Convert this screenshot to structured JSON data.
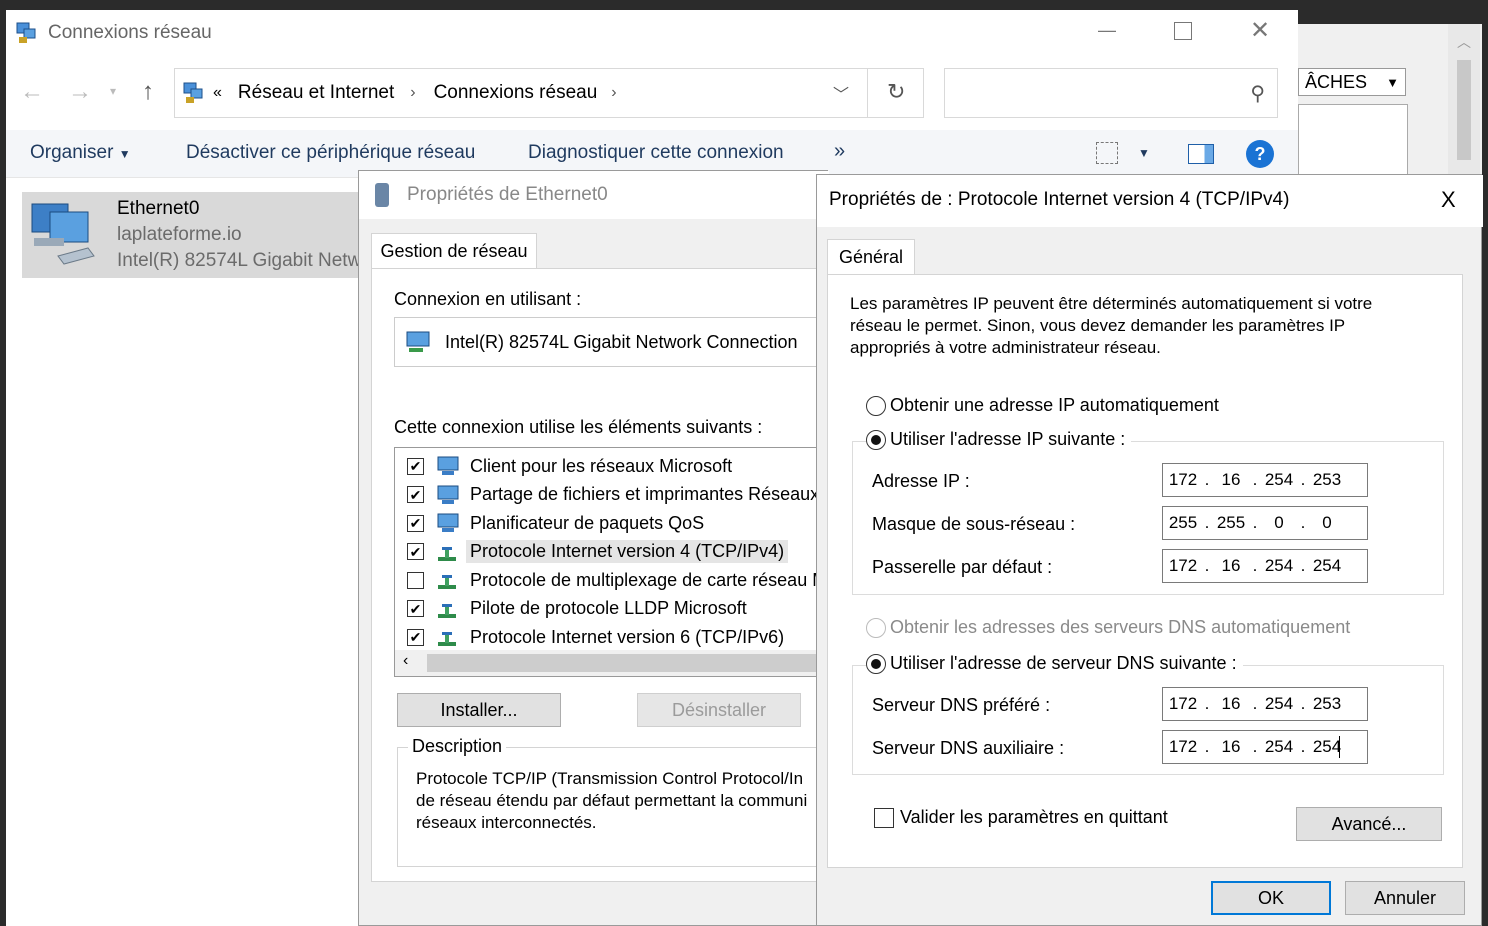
{
  "explorer": {
    "title": "Connexions réseau",
    "breadcrumb": [
      "Réseau et Internet",
      "Connexions réseau"
    ],
    "toolbar": {
      "organize": "Organiser",
      "disable": "Désactiver ce périphérique réseau",
      "diagnose": "Diagnostiquer cette connexion",
      "more": "»"
    },
    "connection": {
      "name": "Ethernet0",
      "domain": "laplateforme.io",
      "adapter": "Intel(R) 82574L Gigabit Netw"
    },
    "behind_window_dropdown": "ÂCHES"
  },
  "eth_props": {
    "title": "Propriétés de Ethernet0",
    "tab": "Gestion de réseau",
    "connect_using_label": "Connexion en utilisant :",
    "adapter": "Intel(R) 82574L Gigabit Network Connection",
    "items_label": "Cette connexion utilise les éléments suivants :",
    "items": [
      {
        "label": "Client pour les réseaux Microsoft",
        "checked": true,
        "icon": "network-client-icon"
      },
      {
        "label": "Partage de fichiers et imprimantes Réseaux M",
        "checked": true,
        "icon": "network-service-icon"
      },
      {
        "label": "Planificateur de paquets QoS",
        "checked": true,
        "icon": "network-service-icon"
      },
      {
        "label": "Protocole Internet version 4 (TCP/IPv4)",
        "checked": true,
        "icon": "protocol-icon"
      },
      {
        "label": "Protocole de multiplexage de carte réseau Mi",
        "checked": false,
        "icon": "protocol-icon"
      },
      {
        "label": "Pilote de protocole LLDP Microsoft",
        "checked": true,
        "icon": "protocol-icon"
      },
      {
        "label": "Protocole Internet version 6 (TCP/IPv6)",
        "checked": true,
        "icon": "protocol-icon"
      }
    ],
    "install_btn": "Installer...",
    "uninstall_btn": "Désinstaller",
    "description_label": "Description",
    "description_lines": [
      "Protocole TCP/IP (Transmission Control Protocol/In",
      "de réseau étendu par défaut permettant la communi",
      "réseaux interconnectés."
    ]
  },
  "ipv4": {
    "title": "Propriétés de : Protocole Internet version 4 (TCP/IPv4)",
    "close": "X",
    "tab": "Général",
    "intro_lines": [
      "Les paramètres IP peuvent être déterminés automatiquement si votre",
      "réseau le permet. Sinon, vous devez demander les paramètres IP",
      "appropriés à votre administrateur réseau."
    ],
    "radio_auto_ip": "Obtenir une adresse IP automatiquement",
    "radio_manual_ip": "Utiliser l'adresse IP suivante :",
    "ip_label": "Adresse IP :",
    "mask_label": "Masque de sous-réseau :",
    "gateway_label": "Passerelle par défaut :",
    "ip": [
      "172",
      "16",
      "254",
      "253"
    ],
    "mask": [
      "255",
      "255",
      "0",
      "0"
    ],
    "gateway": [
      "172",
      "16",
      "254",
      "254"
    ],
    "radio_auto_dns": "Obtenir les adresses des serveurs DNS automatiquement",
    "radio_manual_dns": "Utiliser l'adresse de serveur DNS suivante :",
    "dns1_label": "Serveur DNS préféré :",
    "dns2_label": "Serveur DNS auxiliaire :",
    "dns1": [
      "172",
      "16",
      "254",
      "253"
    ],
    "dns2": [
      "172",
      "16",
      "254",
      "254"
    ],
    "validate_label": "Valider les paramètres en quittant",
    "advanced_btn": "Avancé...",
    "ok_btn": "OK",
    "cancel_btn": "Annuler"
  }
}
